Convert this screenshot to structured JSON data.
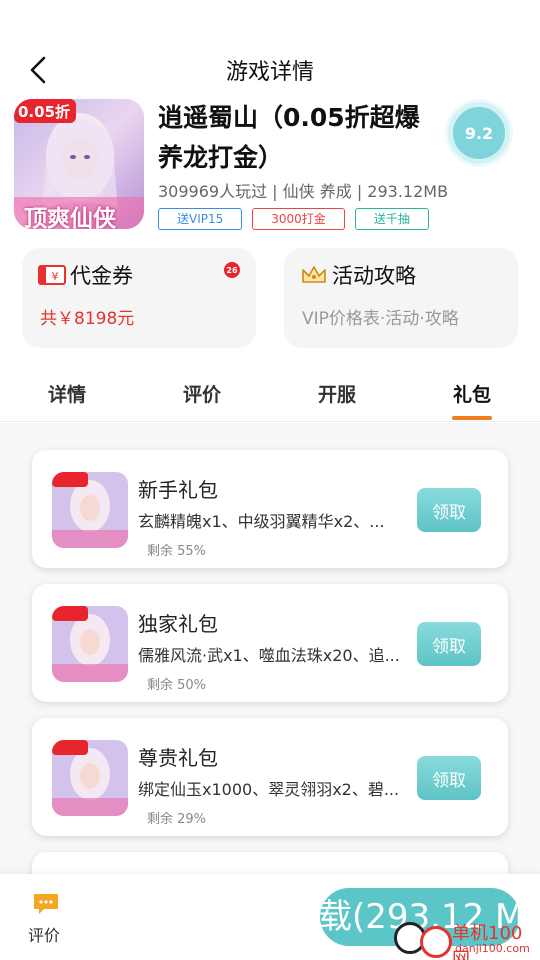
{
  "header": {
    "title": "游戏详情"
  },
  "game": {
    "title": "逍遥蜀山（0.05折超爆养龙打金）",
    "meta": "309969人玩过 | 仙侠 养成 | 293.12MB",
    "score": "9.2",
    "icon_discount": "0.05折",
    "icon_caption": "顶爽仙侠",
    "tags": [
      "送VIP15",
      "3000打金",
      "送千抽"
    ]
  },
  "cards": {
    "voucher": {
      "title": "代金券",
      "subtitle": "共￥8198元",
      "badge": "26"
    },
    "activity": {
      "title": "活动攻略",
      "subtitle": "VIP价格表·活动·攻略"
    }
  },
  "tabs": [
    "详情",
    "评价",
    "开服",
    "礼包"
  ],
  "active_tab": "礼包",
  "gifts": [
    {
      "name": "新手礼包",
      "desc": "玄麟精魄x1、中级羽翼精华x2、...",
      "remain": "剩余 55%",
      "button": "领取"
    },
    {
      "name": "独家礼包",
      "desc": "儒雅风流·武x1、噬血法珠x20、追...",
      "remain": "剩余 50%",
      "button": "领取"
    },
    {
      "name": "尊贵礼包",
      "desc": "绑定仙玉x1000、翠灵翎羽x2、碧...",
      "remain": "剩余 29%",
      "button": "领取"
    }
  ],
  "bottom": {
    "comment_label": "评价",
    "download_label": "载(293.12 M"
  },
  "watermark": {
    "text": "单机100网",
    "sub": "danji100.com"
  },
  "colors": {
    "accent": "#5cc5c8",
    "tab_indicator": "#f07c1d",
    "price_red": "#e8322e"
  },
  "icons": [
    "back-chevron-icon",
    "voucher-icon",
    "crown-icon",
    "comment-icon"
  ]
}
